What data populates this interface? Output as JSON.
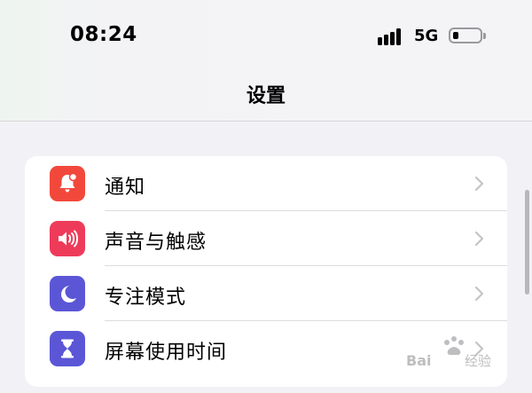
{
  "status_bar": {
    "time": "08:24",
    "network": "5G",
    "signal_bars": 4,
    "battery_level": 0.2
  },
  "nav": {
    "title": "设置"
  },
  "settings": {
    "items": [
      {
        "label": "通知",
        "icon": "bell-badge-icon",
        "color": "#f2483b"
      },
      {
        "label": "声音与触感",
        "icon": "speaker-icon",
        "color": "#ef3b5a"
      },
      {
        "label": "专注模式",
        "icon": "moon-icon",
        "color": "#5b56d6"
      },
      {
        "label": "屏幕使用时间",
        "icon": "hourglass-icon",
        "color": "#5b56d6"
      }
    ]
  },
  "watermark": {
    "text": "Baidu 经验"
  }
}
